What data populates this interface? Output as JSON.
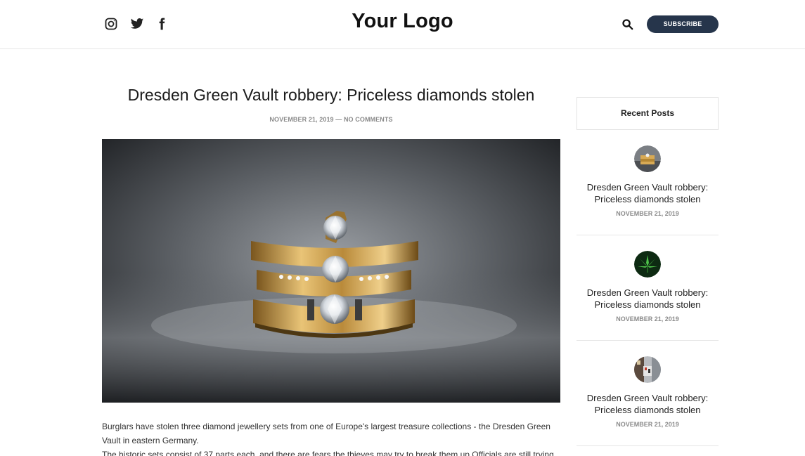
{
  "header": {
    "logo": "Your Logo",
    "subscribe_label": "SUBSCRIBE",
    "social_icons": [
      "instagram-icon",
      "twitter-icon",
      "facebook-icon"
    ],
    "search_icon": "search-icon",
    "accent_color": "#26354b"
  },
  "post": {
    "title": "Dresden Green Vault robbery: Priceless diamonds stolen",
    "meta": "NOVEMBER 21, 2019 — NO COMMENTS",
    "image": "gold-diamond-rings-photo",
    "paragraphs": [
      "Burglars have stolen three diamond jewellery sets from one of Europe's largest treasure collections - the Dresden Green Vault in eastern Germany.",
      "The historic sets consist of 37 parts each, and there are fears the thieves may try to break them up.Officials are still trying to"
    ]
  },
  "sidebar": {
    "widget_title": "Recent Posts",
    "posts": [
      {
        "title": "Dresden Green Vault robbery: Priceless diamonds stolen",
        "date": "NOVEMBER 21, 2019",
        "thumb": "rings-thumbnail"
      },
      {
        "title": "Dresden Green Vault robbery: Priceless diamonds stolen",
        "date": "NOVEMBER 21, 2019",
        "thumb": "cannabis-leaf-thumbnail"
      },
      {
        "title": "Dresden Green Vault robbery: Priceless diamonds stolen",
        "date": "NOVEMBER 21, 2019",
        "thumb": "street-scene-thumbnail"
      }
    ]
  }
}
